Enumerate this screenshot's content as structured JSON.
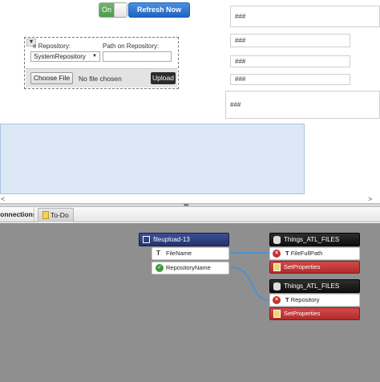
{
  "toolbar": {
    "toggle_label": "On",
    "refresh_label": "Refresh Now"
  },
  "upload": {
    "repository_label": "e Repository:",
    "path_label": "Path on Repository:",
    "repository_value": "SystemRepository",
    "choose_label": "Choose File",
    "no_file_text": "No file chosen",
    "upload_label": "Upload"
  },
  "right_fields": {
    "f1": "###",
    "f2": "###",
    "f3": "###",
    "f4": "###",
    "f5": "###"
  },
  "scroll": {
    "left_arrow": "<",
    "right_arrow": ">"
  },
  "tabs": {
    "connections": "Connections",
    "todo": "To-Do"
  },
  "mashup": {
    "source": {
      "title": "fileupload-13",
      "prop1": "FileName",
      "prop2": "RepositoryName"
    },
    "target1": {
      "title": "Things_ATL_FILES",
      "param": "FileFullPath",
      "service": "SetProperties"
    },
    "target2": {
      "title": "Things_ATL_FILES",
      "param": "Repository",
      "service": "SetProperties"
    }
  },
  "colors": {
    "accent": "#1f63c2",
    "toggle_on": "#4e9a4e",
    "node_header_blue": "#2a3a7a",
    "node_header_dark": "#1a1a1a",
    "service_red": "#b22b2b",
    "wire_blue": "#3d8fe0",
    "canvas_grey": "#8f8f8f"
  }
}
